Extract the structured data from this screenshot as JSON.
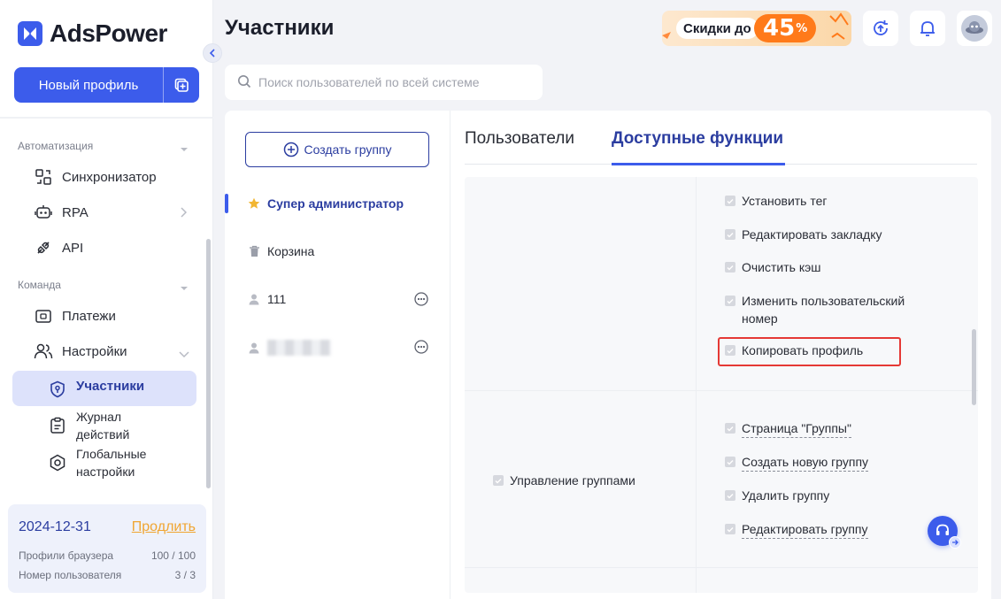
{
  "app": {
    "name": "AdsPower"
  },
  "sidebar": {
    "new_profile_label": "Новый профиль",
    "sections": {
      "automation": "Автоматизация",
      "team": "Команда"
    },
    "items": {
      "sync": "Синхронизатор",
      "rpa": "RPA",
      "api": "API",
      "payments": "Платежи",
      "settings": "Настройки"
    },
    "sub_items": {
      "members": "Участники",
      "log": "Журнал действий",
      "global": "Глобальные настройки"
    },
    "plan": {
      "date": "2024-12-31",
      "renew": "Продлить",
      "browser_profiles_label": "Профили браузера",
      "browser_profiles_value": "100 / 100",
      "user_count_label": "Номер пользователя",
      "user_count_value": "3 / 3"
    }
  },
  "header": {
    "title": "Участники",
    "promo_text": "Скидки до",
    "promo_value": "45",
    "promo_unit": "%"
  },
  "search": {
    "placeholder": "Поиск пользователей по всей системе"
  },
  "groups": {
    "create_label": "Создать группу",
    "items": {
      "super_admin": "Супер администратор",
      "trash": "Корзина",
      "user_111": "111"
    }
  },
  "tabs": {
    "users": "Пользователи",
    "features": "Доступные функции"
  },
  "permissions": {
    "profile_ops": [
      "Установить тег",
      "Редактировать закладку",
      "Очистить кэш",
      "Изменить пользовательский номер",
      "Копировать профиль"
    ],
    "group_category": "Управление группами",
    "group_ops": [
      "Страница \"Группы\"",
      "Создать новую группу",
      "Удалить группу",
      "Редактировать группу"
    ]
  },
  "colors": {
    "accent": "#3c5ceb",
    "accent_dark": "#2b3da0",
    "promo": "#ff7a1a",
    "renew": "#f0a531",
    "highlight": "#e53935"
  }
}
